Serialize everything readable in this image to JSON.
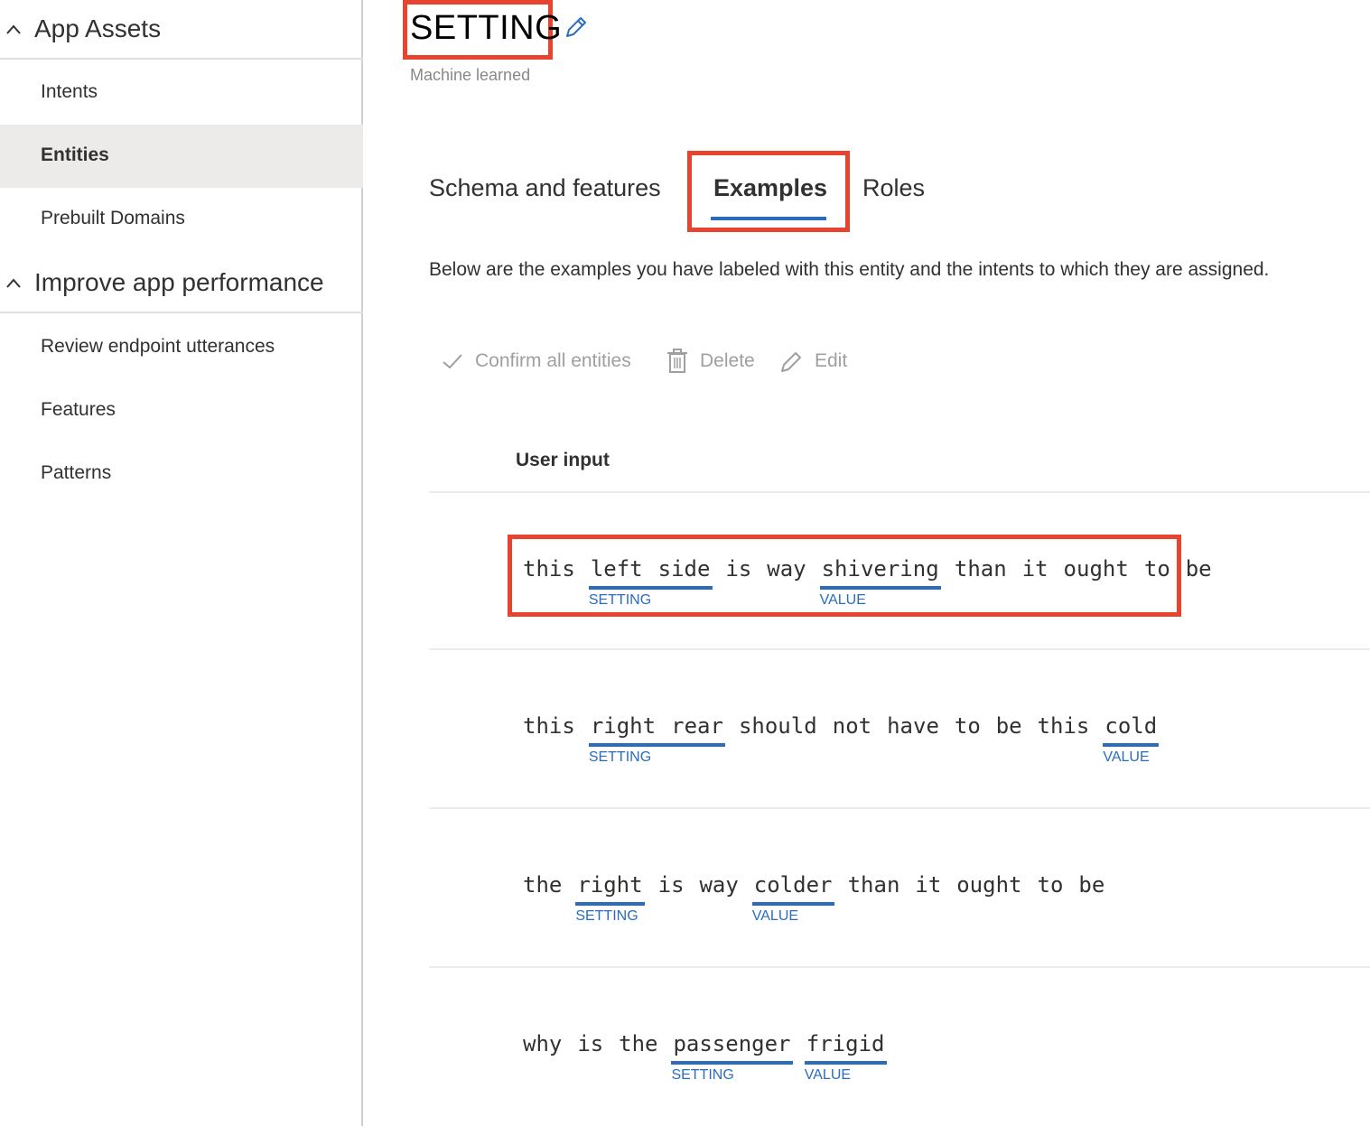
{
  "sidebar": {
    "groups": [
      {
        "title": "App Assets",
        "icon": "chevron-up-icon",
        "items": [
          {
            "label": "Intents"
          },
          {
            "label": "Entities",
            "active": true
          },
          {
            "label": "Prebuilt Domains"
          }
        ]
      },
      {
        "title": "Improve app performance",
        "icon": "chevron-up-icon",
        "items": [
          {
            "label": "Review endpoint utterances"
          },
          {
            "label": "Features"
          },
          {
            "label": "Patterns"
          }
        ]
      }
    ]
  },
  "entity": {
    "name": "SETTING",
    "type": "Machine learned",
    "edit_icon": "pencil-icon"
  },
  "tabs": [
    {
      "label": "Schema and features"
    },
    {
      "label": "Examples",
      "selected": true
    },
    {
      "label": "Roles"
    }
  ],
  "description": "Below are the examples you have labeled with this entity and the intents to which they are assigned.",
  "toolbar": {
    "confirm_label": "Confirm all entities",
    "confirm_icon": "checkmark-icon",
    "delete_label": "Delete",
    "delete_icon": "trash-icon",
    "edit_label": "Edit",
    "edit_icon": "pencil-icon"
  },
  "table": {
    "column_header": "User input",
    "rows": [
      {
        "words": [
          "this",
          "left",
          "side",
          "is",
          "way",
          "shivering",
          "than",
          "it",
          "ought",
          "to",
          "be"
        ],
        "entities": [
          {
            "label": "SETTING",
            "start": 1,
            "end": 2
          },
          {
            "label": "VALUE",
            "start": 5,
            "end": 5
          }
        ]
      },
      {
        "words": [
          "this",
          "right",
          "rear",
          "should",
          "not",
          "have",
          "to",
          "be",
          "this",
          "cold"
        ],
        "entities": [
          {
            "label": "SETTING",
            "start": 1,
            "end": 2
          },
          {
            "label": "VALUE",
            "start": 9,
            "end": 9
          }
        ]
      },
      {
        "words": [
          "the",
          "right",
          "is",
          "way",
          "colder",
          "than",
          "it",
          "ought",
          "to",
          "be"
        ],
        "entities": [
          {
            "label": "SETTING",
            "start": 1,
            "end": 1
          },
          {
            "label": "VALUE",
            "start": 4,
            "end": 4
          }
        ]
      },
      {
        "words": [
          "why",
          "is",
          "the",
          "passenger",
          "frigid"
        ],
        "entities": [
          {
            "label": "SETTING",
            "start": 3,
            "end": 3
          },
          {
            "label": "VALUE",
            "start": 4,
            "end": 4
          }
        ]
      }
    ]
  },
  "colors": {
    "accent": "#2b6dbc",
    "highlight": "#e8432e",
    "selected_nav": "#edebe9"
  }
}
